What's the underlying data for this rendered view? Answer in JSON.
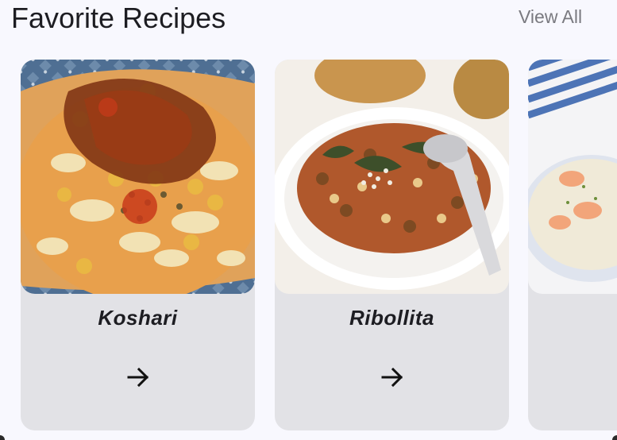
{
  "header": {
    "title": "Favorite Recipes",
    "view_all_label": "View All"
  },
  "recipes": [
    {
      "name": "Koshari",
      "action_icon": "arrow-right-icon"
    },
    {
      "name": "Ribollita",
      "action_icon": "arrow-right-icon"
    },
    {
      "name": "",
      "action_icon": "arrow-right-icon"
    }
  ],
  "colors": {
    "background": "#f8f8fe",
    "card": "#e2e2e6",
    "title_text": "#1d1d22",
    "link_text": "#7a7a80"
  }
}
